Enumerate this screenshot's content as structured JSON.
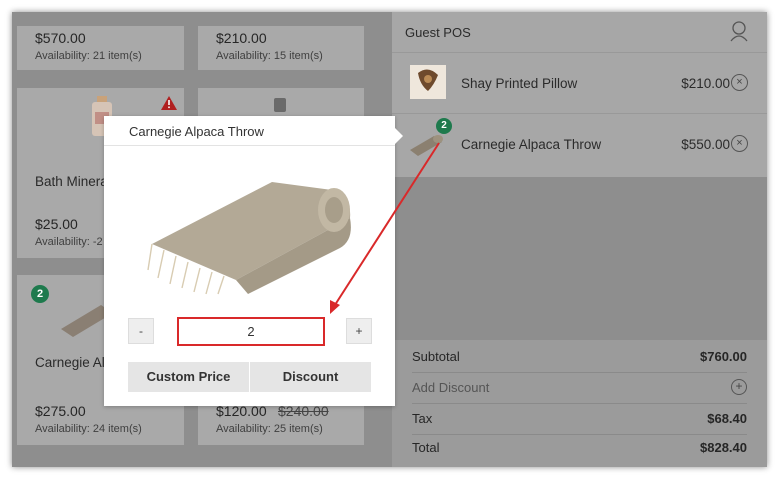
{
  "products": [
    {
      "price": "$570.00",
      "availability": "Availability: 21 item(s)"
    },
    {
      "price": "$210.00",
      "availability": "Availability: 15 item(s)"
    },
    {
      "name": "Bath Minera",
      "price": "$25.00",
      "availability": "Availability: -2"
    },
    {
      "name": "Carnegie Alp",
      "badge": "2",
      "price": "$275.00",
      "availability": "Availability: 24 item(s)"
    },
    {
      "price": "$120.00",
      "old_price": "$240.00",
      "availability": "Availability: 25 item(s)"
    }
  ],
  "cart": {
    "title": "Guest POS",
    "items": [
      {
        "name": "Shay Printed Pillow",
        "price": "$210.00"
      },
      {
        "name": "Carnegie Alpaca Throw",
        "price": "$550.00",
        "badge": "2"
      }
    ],
    "summary": {
      "subtotal_label": "Subtotal",
      "subtotal": "$760.00",
      "discount_label": "Add Discount",
      "tax_label": "Tax",
      "tax": "$68.40",
      "total_label": "Total",
      "total": "$828.40"
    }
  },
  "modal": {
    "title": "Carnegie Alpaca Throw",
    "minus": "-",
    "plus": "+",
    "quantity": "2",
    "custom_price_label": "Custom Price",
    "discount_label": "Discount"
  },
  "colors": {
    "annotation": "#d9292a",
    "badge": "#1e7a4d"
  }
}
